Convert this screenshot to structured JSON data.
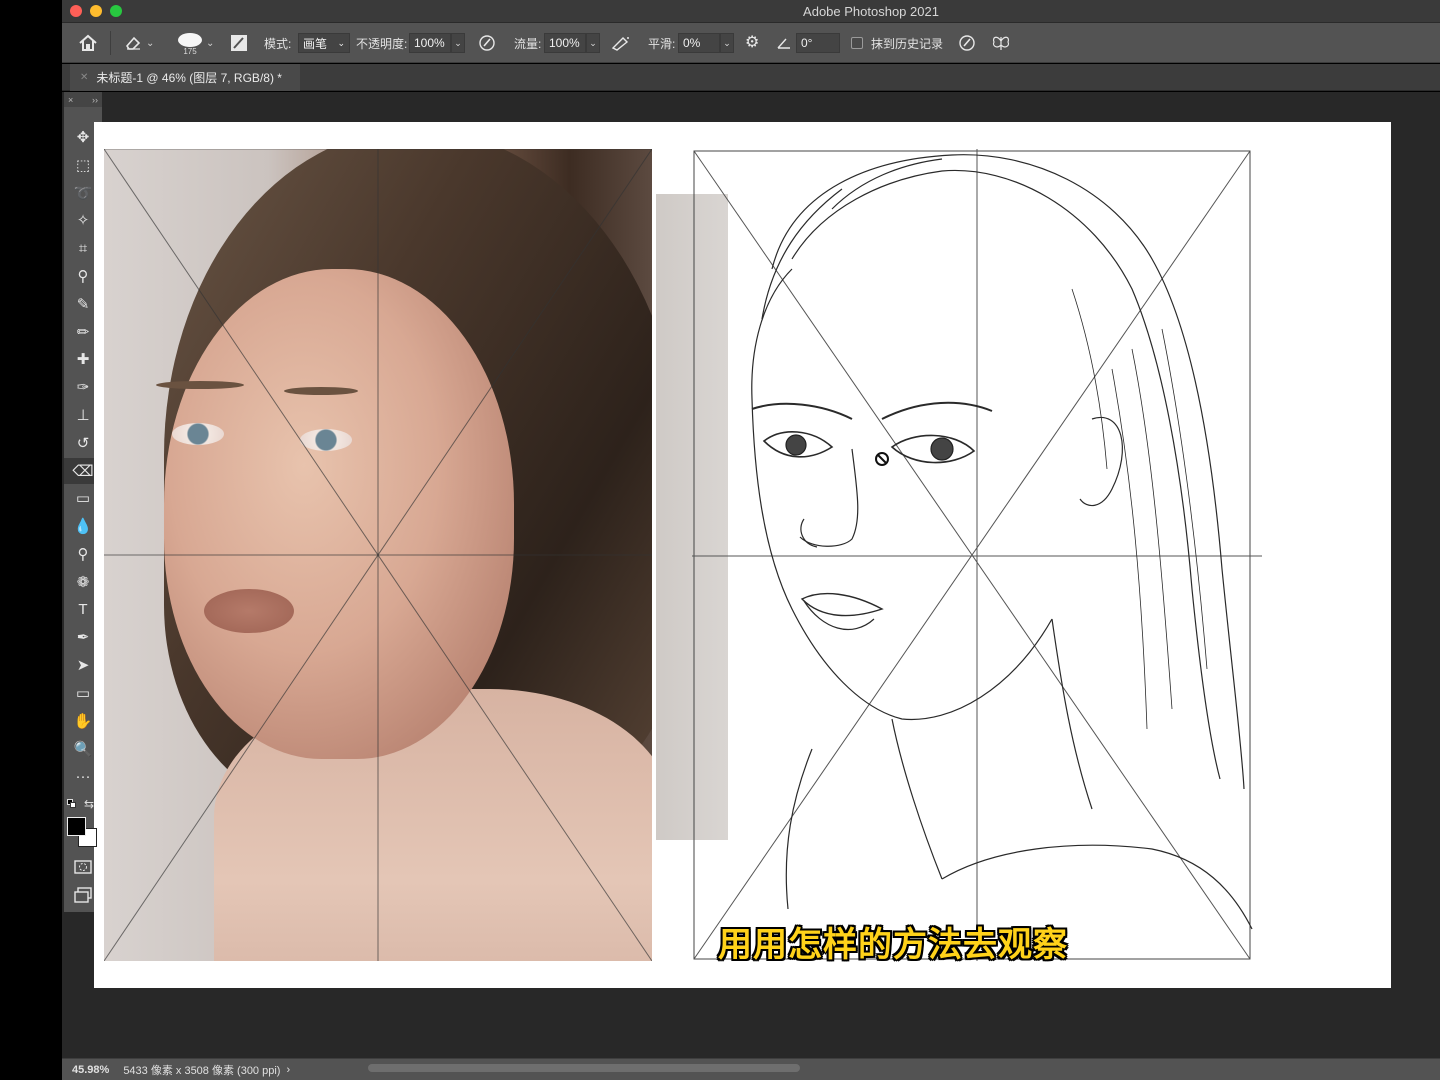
{
  "window": {
    "app_title": "Adobe Photoshop 2021"
  },
  "options_bar": {
    "home_icon": "home-icon",
    "tool_icon": "eraser-icon",
    "brush_size": "175",
    "mode_label": "模式:",
    "mode_value": "画笔",
    "opacity_label": "不透明度:",
    "opacity_value": "100%",
    "flow_label": "流量:",
    "flow_value": "100%",
    "smoothing_label": "平滑:",
    "smoothing_value": "0%",
    "angle_value": "0°",
    "erase_history_label": "抹到历史记录"
  },
  "document_tab": {
    "label": "未标题-1 @ 46% (图层 7, RGB/8) *"
  },
  "toolbar": {
    "head_close": "×",
    "head_expand": "››",
    "tools": [
      {
        "name": "move-tool",
        "glyph": "✥"
      },
      {
        "name": "marquee-tool",
        "glyph": "⬚"
      },
      {
        "name": "lasso-tool",
        "glyph": "➰"
      },
      {
        "name": "magic-wand-tool",
        "glyph": "✧"
      },
      {
        "name": "crop-tool",
        "glyph": "⌗"
      },
      {
        "name": "eyedropper-tool",
        "glyph": "⚲"
      },
      {
        "name": "brush-tool",
        "glyph": "✎"
      },
      {
        "name": "pencil-tool",
        "glyph": "✏"
      },
      {
        "name": "healing-tool",
        "glyph": "✚"
      },
      {
        "name": "mixer-brush-tool",
        "glyph": "✑"
      },
      {
        "name": "stamp-tool",
        "glyph": "⊥"
      },
      {
        "name": "history-brush-tool",
        "glyph": "↺"
      },
      {
        "name": "eraser-tool",
        "glyph": "⌫"
      },
      {
        "name": "gradient-tool",
        "glyph": "▭"
      },
      {
        "name": "blur-tool",
        "glyph": "💧"
      },
      {
        "name": "dodge-tool",
        "glyph": "⚲"
      },
      {
        "name": "sponge-tool",
        "glyph": "❁"
      },
      {
        "name": "type-tool",
        "glyph": "T"
      },
      {
        "name": "pen-tool",
        "glyph": "✒"
      },
      {
        "name": "path-select-tool",
        "glyph": "➤"
      },
      {
        "name": "rectangle-tool",
        "glyph": "▭"
      },
      {
        "name": "hand-tool",
        "glyph": "✋"
      },
      {
        "name": "zoom-tool",
        "glyph": "🔍"
      },
      {
        "name": "more-tools",
        "glyph": "···"
      }
    ]
  },
  "canvas": {
    "subtitle": "用用怎样的方法去观察"
  },
  "status_bar": {
    "zoom": "45.98%",
    "doc_info": "5433 像素 x 3508 像素 (300 ppi)",
    "arrow": "›"
  },
  "colors": {
    "foreground": "#000000",
    "background": "#ffffff",
    "subtitle_fill": "#ffd21a"
  }
}
